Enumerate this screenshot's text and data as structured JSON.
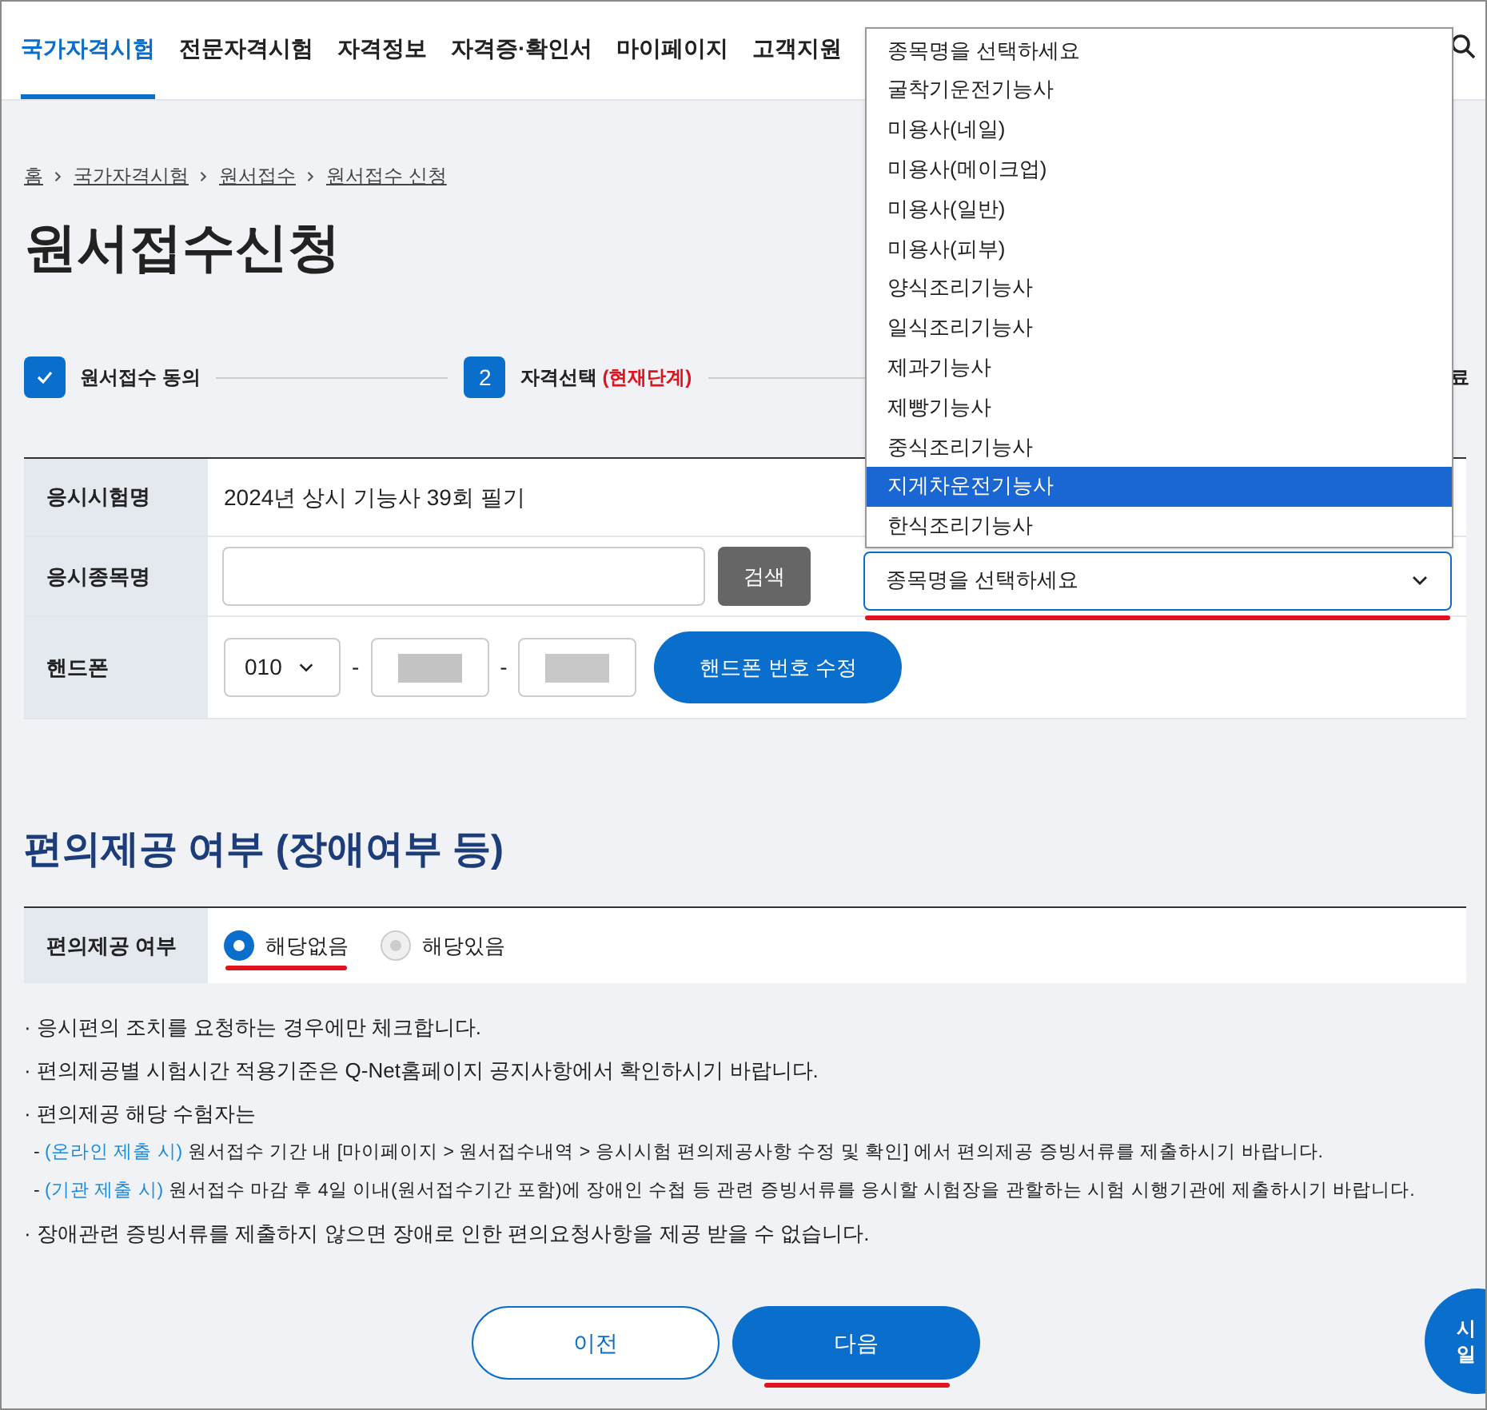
{
  "nav": {
    "items": [
      {
        "label": "국가자격시험",
        "selected": true
      },
      {
        "label": "전문자격시험",
        "selected": false
      },
      {
        "label": "자격정보",
        "selected": false
      },
      {
        "label": "자격증·확인서",
        "selected": false
      },
      {
        "label": "마이페이지",
        "selected": false
      },
      {
        "label": "고객지원",
        "selected": false
      }
    ]
  },
  "breadcrumb": [
    "홈",
    "국가자격시험",
    "원서접수",
    "원서접수 신청"
  ],
  "page_title": "원서접수신청",
  "steps": [
    {
      "kind": "done",
      "label": "원서접수 동의"
    },
    {
      "kind": "current",
      "number": "2",
      "label": "자격선택",
      "note": "(현재단계)"
    },
    {
      "kind": "partial",
      "label": "료"
    }
  ],
  "form": {
    "exam_name": {
      "label": "응시시험명",
      "value": "2024년 상시 기능사 39회 필기"
    },
    "subject": {
      "label": "응시종목명",
      "search_button": "검색",
      "select": {
        "value": "종목명을 선택하세요",
        "annotated": true
      }
    },
    "phone": {
      "label": "핸드폰",
      "prefix": "010",
      "separators": [
        "-",
        "-"
      ],
      "button": "핸드폰 번호 수정"
    }
  },
  "dropdown": {
    "options": [
      {
        "label": "종목명을 선택하세요",
        "selected": false
      },
      {
        "label": "굴착기운전기능사",
        "selected": false
      },
      {
        "label": "미용사(네일)",
        "selected": false
      },
      {
        "label": "미용사(메이크업)",
        "selected": false
      },
      {
        "label": "미용사(일반)",
        "selected": false
      },
      {
        "label": "미용사(피부)",
        "selected": false
      },
      {
        "label": "양식조리기능사",
        "selected": false
      },
      {
        "label": "일식조리기능사",
        "selected": false
      },
      {
        "label": "제과기능사",
        "selected": false
      },
      {
        "label": "제빵기능사",
        "selected": false
      },
      {
        "label": "중식조리기능사",
        "selected": false
      },
      {
        "label": "지게차운전기능사",
        "selected": true
      },
      {
        "label": "한식조리기능사",
        "selected": false
      }
    ]
  },
  "section_title": "편의제공 여부 (장애여부 등)",
  "accommodation": {
    "label": "편의제공 여부",
    "options": [
      {
        "label": "해당없음",
        "selected": true,
        "annotated": true
      },
      {
        "label": "해당있음",
        "selected": false
      }
    ]
  },
  "notes": [
    {
      "kind": "bullet",
      "marker": "·",
      "text": "응시편의 조치를 요청하는 경우에만 체크합니다."
    },
    {
      "kind": "bullet",
      "marker": "·",
      "text": "편의제공별 시험시간 적용기준은 Q-Net홈페이지 공지사항에서 확인하시기 바랍니다."
    },
    {
      "kind": "bullet",
      "marker": "·",
      "text": "편의제공 해당 수험자는"
    },
    {
      "kind": "sub",
      "marker": "-",
      "prefix": "(온라인 제출 시)",
      "text": "원서접수 기간 내 [마이페이지 > 원서접수내역 > 응시시험 편의제공사항 수정 및 확인] 에서 편의제공 증빙서류를 제출하시기 바랍니다."
    },
    {
      "kind": "sub",
      "marker": "-",
      "prefix": "(기관 제출 시)",
      "text": "원서접수 마감 후 4일 이내(원서접수기간 포함)에 장애인 수첩 등 관련 증빙서류를 응시할 시험장을 관할하는 시험 시행기관에 제출하시기 바랍니다."
    },
    {
      "kind": "bullet",
      "marker": "·",
      "text": "장애관련 증빙서류를 제출하지 않으면 장애로 인한 편의요청사항을 제공 받을 수 없습니다."
    }
  ],
  "buttons": [
    {
      "label": "이전",
      "kind": "outline"
    },
    {
      "label": "다음",
      "kind": "primary",
      "annotated": true
    }
  ],
  "floating_button": {
    "lines": [
      "시",
      "일"
    ]
  }
}
